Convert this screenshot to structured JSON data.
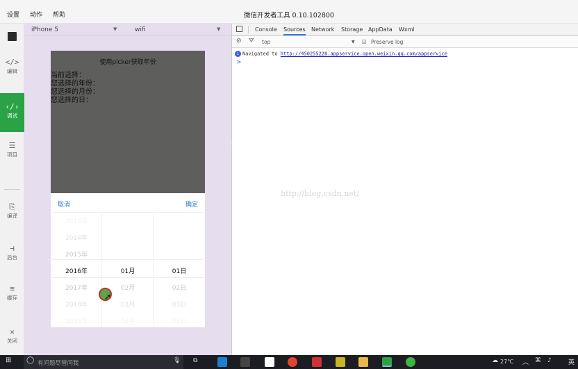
{
  "menubar": {
    "items": [
      "设置",
      "动作",
      "帮助"
    ],
    "title": "微信开发者工具 0.10.102800"
  },
  "sidebar": {
    "items": [
      {
        "label": "编辑",
        "icon": "code-file-icon"
      },
      {
        "label": "调试",
        "icon": "code-brackets-icon",
        "active": true
      },
      {
        "label": "项目",
        "icon": "menu-icon"
      },
      {
        "label": "编译",
        "icon": "compile-icon"
      },
      {
        "label": "后台",
        "icon": "backend-icon"
      },
      {
        "label": "缓存",
        "icon": "layers-icon"
      },
      {
        "label": "关闭",
        "icon": "close-icon"
      }
    ]
  },
  "simulator": {
    "device": "iPhone 5",
    "network": "wifi",
    "page_title": "使用picker获取年份",
    "lines": [
      "当前选择：",
      "您选择的年份：",
      "您选择的月份：",
      "您选择的日："
    ],
    "picker": {
      "cancel": "取消",
      "confirm": "确定",
      "years": [
        "2013年",
        "2014年",
        "2015年",
        "2016年",
        "2017年",
        "2018年",
        "2019年"
      ],
      "months": [
        "01月",
        "02月",
        "03月",
        "04月"
      ],
      "days": [
        "01日",
        "02日",
        "03日",
        "04日"
      ],
      "selected_index_year": 3,
      "selected_index_other": 0
    }
  },
  "devtools": {
    "tabs": [
      "Console",
      "Sources",
      "Network",
      "Storage",
      "AppData",
      "Wxml"
    ],
    "active_tab": "Sources",
    "filter": {
      "context": "top",
      "preserve_log_label": "Preserve log",
      "preserve_log_checked": true
    },
    "console": {
      "navigated_prefix": "Navigated to",
      "navigated_url": "http://450255228.appservice.open.weixin.qq.com/appservice",
      "prompt": ">"
    },
    "watermark": "http://blog.csdn.net/"
  },
  "taskbar": {
    "search_placeholder": "有问题尽管问我",
    "weather": "27℃",
    "lang": "英"
  },
  "colors": {
    "accent_green": "#2ba245",
    "link_blue": "#2a7bc6",
    "simulator_bg": "#e6ddef",
    "mask_gray": "#5e5f5d"
  }
}
